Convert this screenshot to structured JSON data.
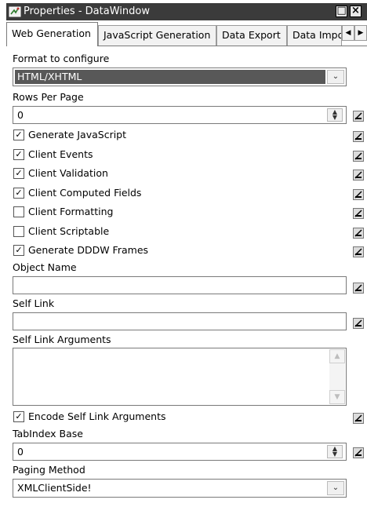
{
  "window": {
    "title": "Properties - DataWindow",
    "restore_glyph": "□",
    "close_glyph": "×"
  },
  "tabs": [
    {
      "label": "Web Generation"
    },
    {
      "label": "JavaScript Generation"
    },
    {
      "label": "Data Export"
    },
    {
      "label": "Data Impo"
    }
  ],
  "tab_scroll": {
    "left": "◀",
    "right": "▶"
  },
  "form": {
    "format_label": "Format to configure",
    "format_value": "HTML/XHTML",
    "rows_label": "Rows Per Page",
    "rows_value": "0",
    "checks": [
      {
        "label": "Generate JavaScript",
        "checked": true
      },
      {
        "label": "Client Events",
        "checked": true
      },
      {
        "label": "Client Validation",
        "checked": true
      },
      {
        "label": "Client Computed Fields",
        "checked": true
      },
      {
        "label": "Client Formatting",
        "checked": false
      },
      {
        "label": "Client Scriptable",
        "checked": false
      },
      {
        "label": "Generate DDDW Frames",
        "checked": true
      }
    ],
    "object_name_label": "Object Name",
    "object_name_value": "",
    "self_link_label": "Self Link",
    "self_link_value": "",
    "self_link_args_label": "Self Link Arguments",
    "self_link_args_value": "",
    "encode_label": "Encode Self Link Arguments",
    "encode_checked": true,
    "tabindex_label": "TabIndex Base",
    "tabindex_value": "0",
    "paging_label": "Paging Method",
    "paging_value": "XMLClientSide!"
  },
  "glyphs": {
    "check": "✓",
    "dropdown": "⌄",
    "spin_up": "▲",
    "spin_down": "▼",
    "scroll_up": "︿",
    "scroll_down": "﹀"
  },
  "icons": {
    "window_icon": "properties-icon",
    "side_button": "expression-button-icon"
  },
  "colors": {
    "titlebar": "#3b3b3b",
    "selected_item": "#585858"
  }
}
